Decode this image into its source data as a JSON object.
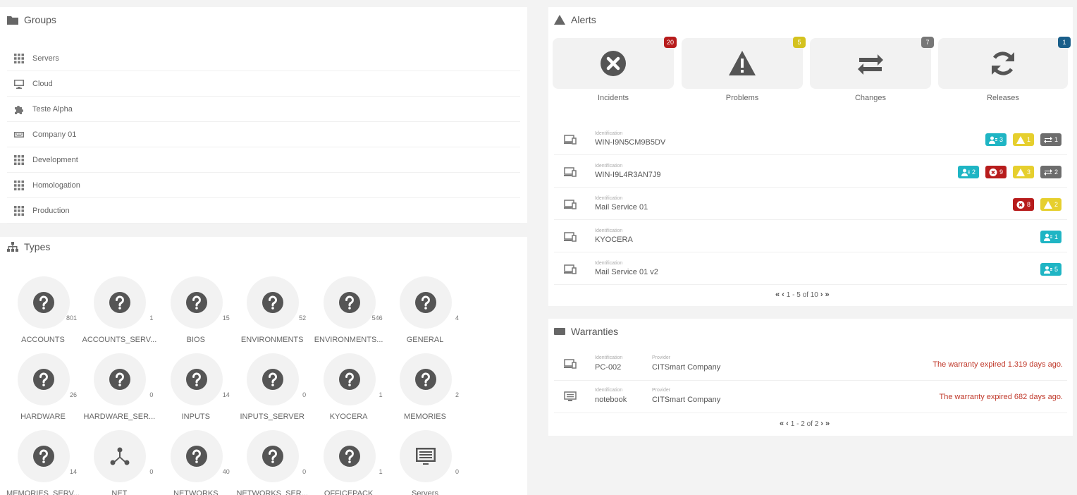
{
  "groups": {
    "title": "Groups",
    "items": [
      {
        "label": "Servers",
        "icon": "grid-icon"
      },
      {
        "label": "Cloud",
        "icon": "monitor-icon"
      },
      {
        "label": "Teste Alpha",
        "icon": "puzzle-icon"
      },
      {
        "label": "Company 01",
        "icon": "keyboard-icon"
      },
      {
        "label": "Development",
        "icon": "grid-icon"
      },
      {
        "label": "Homologation",
        "icon": "grid-icon"
      },
      {
        "label": "Production",
        "icon": "grid-icon"
      }
    ]
  },
  "types": {
    "title": "Types",
    "items": [
      {
        "label": "ACCOUNTS",
        "count": "801",
        "icon": "question-icon"
      },
      {
        "label": "ACCOUNTS_SERV...",
        "count": "1",
        "icon": "question-icon"
      },
      {
        "label": "BIOS",
        "count": "15",
        "icon": "question-icon"
      },
      {
        "label": "ENVIRONMENTS",
        "count": "52",
        "icon": "question-icon"
      },
      {
        "label": "ENVIRONMENTS...",
        "count": "546",
        "icon": "question-icon"
      },
      {
        "label": "GENERAL",
        "count": "4",
        "icon": "question-icon"
      },
      {
        "label": "HARDWARE",
        "count": "26",
        "icon": "question-icon"
      },
      {
        "label": "HARDWARE_SER...",
        "count": "0",
        "icon": "question-icon"
      },
      {
        "label": "INPUTS",
        "count": "14",
        "icon": "question-icon"
      },
      {
        "label": "INPUTS_SERVER",
        "count": "0",
        "icon": "question-icon"
      },
      {
        "label": "KYOCERA",
        "count": "1",
        "icon": "question-icon"
      },
      {
        "label": "MEMORIES",
        "count": "2",
        "icon": "question-icon"
      },
      {
        "label": "MEMORIES_SERV...",
        "count": "14",
        "icon": "question-icon"
      },
      {
        "label": "NET",
        "count": "0",
        "icon": "network-icon"
      },
      {
        "label": "NETWORKS",
        "count": "40",
        "icon": "question-icon"
      },
      {
        "label": "NETWORKS_SER...",
        "count": "0",
        "icon": "question-icon"
      },
      {
        "label": "OFFICEPACK",
        "count": "1",
        "icon": "question-icon"
      },
      {
        "label": "Servers",
        "count": "0",
        "icon": "server-screen-icon"
      }
    ]
  },
  "alerts": {
    "title": "Alerts",
    "cards": [
      {
        "label": "Incidents",
        "count": "20",
        "icon": "x-circle-icon",
        "badge_color": "#b71c1c"
      },
      {
        "label": "Problems",
        "count": "5",
        "icon": "warning-icon",
        "badge_color": "#d4c21f"
      },
      {
        "label": "Changes",
        "count": "7",
        "icon": "swap-arrows-icon",
        "badge_color": "#777777"
      },
      {
        "label": "Releases",
        "count": "1",
        "icon": "refresh-icon",
        "badge_color": "#1a5f8a"
      }
    ],
    "caption": "Identification",
    "devices": [
      {
        "name": "WIN-I9N5CM9B5DV",
        "chips": [
          {
            "type": "user",
            "value": "3"
          },
          {
            "type": "warning",
            "value": "1"
          },
          {
            "type": "change",
            "value": "1"
          }
        ]
      },
      {
        "name": "WIN-I9L4R3AN7J9",
        "chips": [
          {
            "type": "user",
            "value": "2"
          },
          {
            "type": "incident",
            "value": "9"
          },
          {
            "type": "warning",
            "value": "3"
          },
          {
            "type": "change",
            "value": "2"
          }
        ]
      },
      {
        "name": "Mail Service 01",
        "chips": [
          {
            "type": "incident",
            "value": "8"
          },
          {
            "type": "warning",
            "value": "2"
          }
        ]
      },
      {
        "name": "KYOCERA",
        "chips": [
          {
            "type": "user",
            "value": "1"
          }
        ]
      },
      {
        "name": "Mail Service 01 v2",
        "chips": [
          {
            "type": "user",
            "value": "5"
          }
        ]
      }
    ],
    "pager": "1 - 5 of 10"
  },
  "warranties": {
    "title": "Warranties",
    "id_caption": "Identification",
    "provider_caption": "Provider",
    "rows": [
      {
        "name": "PC-002",
        "provider": "CITSmart Company",
        "message": "The warranty expired 1.319 days ago."
      },
      {
        "name": "notebook",
        "provider": "CITSmart Company",
        "message": "The warranty expired 682 days ago."
      }
    ],
    "pager": "1 - 2 of 2"
  },
  "colors": {
    "user": "#1fb5c4",
    "warning": "#e6cf2e",
    "change": "#6d6d6d",
    "incident": "#b71c1c",
    "expired": "#c0392b"
  }
}
